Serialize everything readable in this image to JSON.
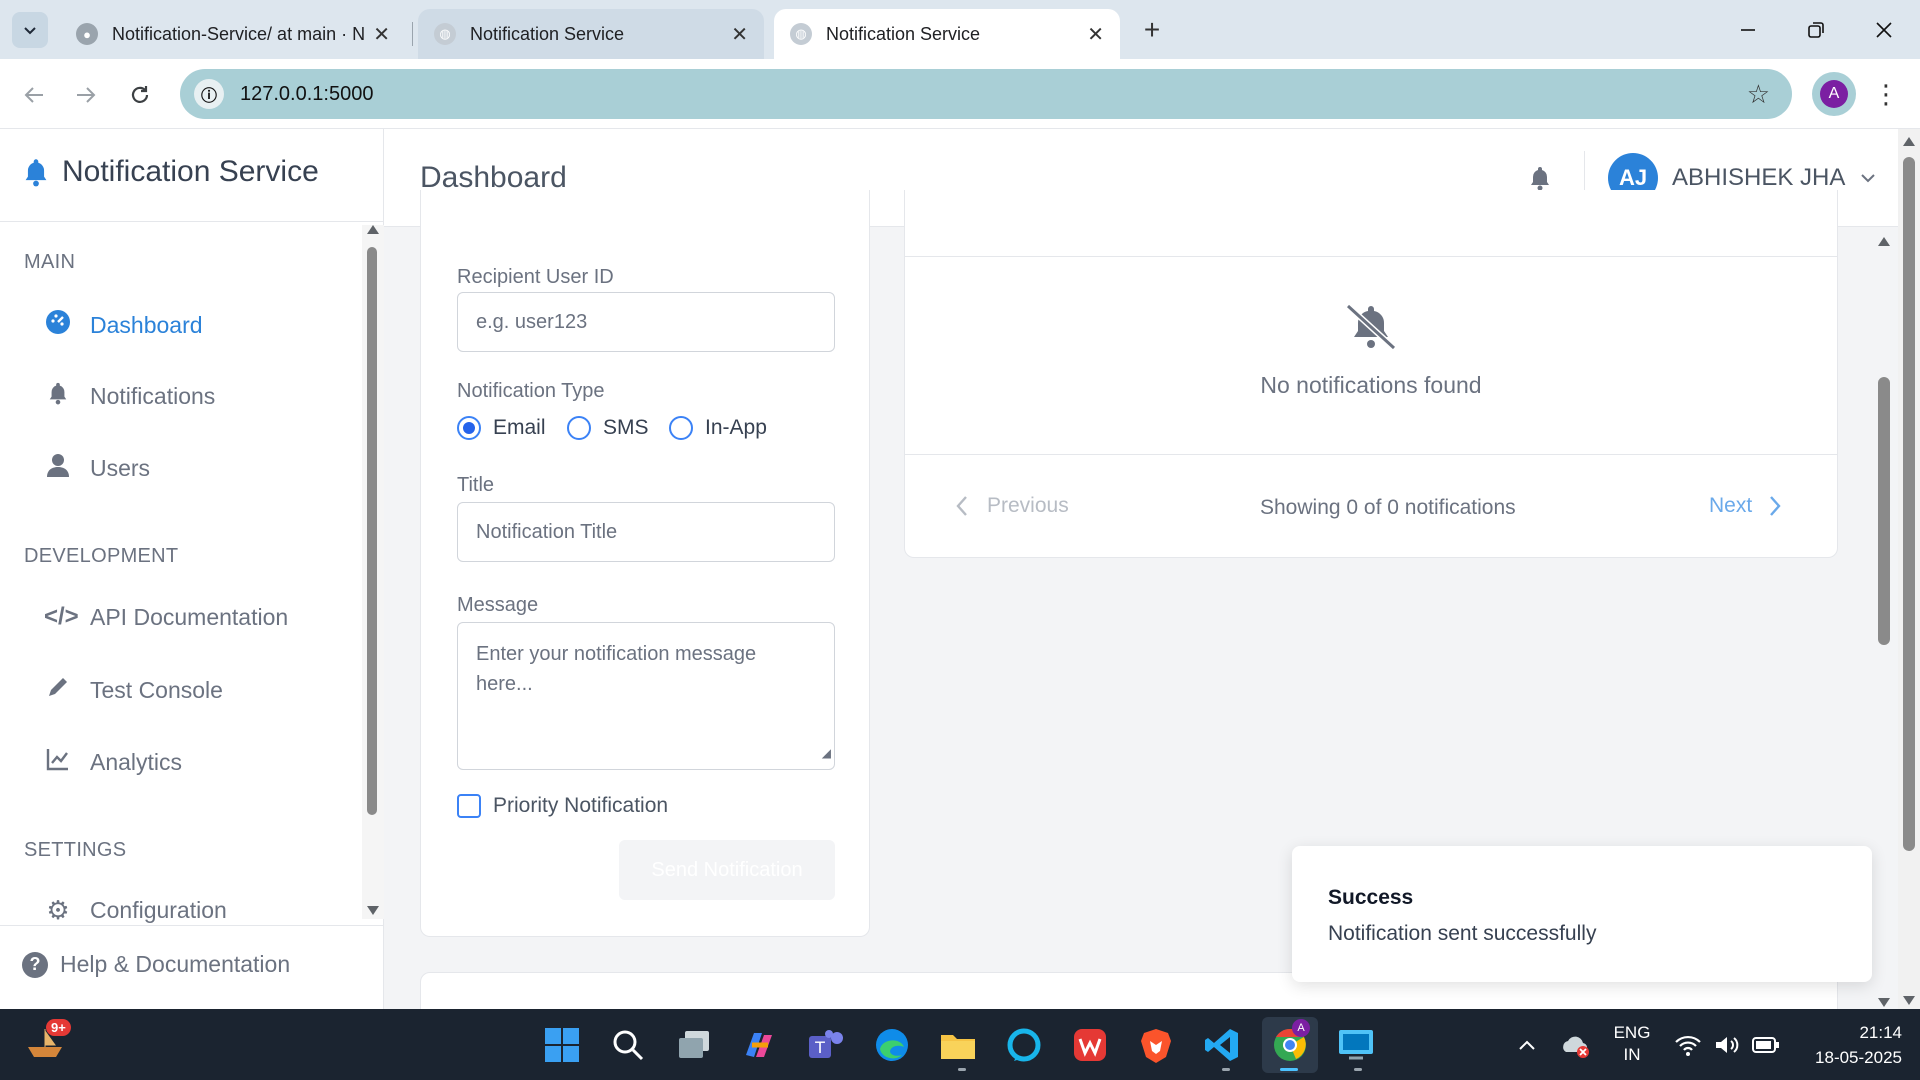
{
  "browser": {
    "tabs": [
      {
        "label": "Notification-Service/ at main · N",
        "icon": "github-icon"
      },
      {
        "label": "Notification Service",
        "icon": "globe-icon"
      },
      {
        "label": "Notification Service",
        "icon": "globe-icon"
      }
    ],
    "address": "127.0.0.1:5000",
    "profile_initial": "A"
  },
  "app": {
    "brand": "Notification Service",
    "page_title": "Dashboard",
    "user": {
      "initials": "AJ",
      "name": "ABHISHEK JHA"
    },
    "sidebar": {
      "sections": [
        {
          "title": "MAIN",
          "items": [
            {
              "label": "Dashboard",
              "icon": "dashboard-icon"
            },
            {
              "label": "Notifications",
              "icon": "bell-icon"
            },
            {
              "label": "Users",
              "icon": "user-icon"
            }
          ]
        },
        {
          "title": "DEVELOPMENT",
          "items": [
            {
              "label": "API Documentation",
              "icon": "code-icon"
            },
            {
              "label": "Test Console",
              "icon": "pencil-icon"
            },
            {
              "label": "Analytics",
              "icon": "chart-line-icon"
            }
          ]
        },
        {
          "title": "SETTINGS",
          "items": [
            {
              "label": "Configuration",
              "icon": "gear-icon"
            }
          ]
        }
      ],
      "help": "Help & Documentation"
    },
    "form": {
      "recipient_label": "Recipient User ID",
      "recipient_placeholder": "e.g. user123",
      "type_label": "Notification Type",
      "types": [
        "Email",
        "SMS",
        "In-App"
      ],
      "selected_type": "Email",
      "title_label": "Title",
      "title_placeholder": "Notification Title",
      "message_label": "Message",
      "message_placeholder": "Enter your notification message here...",
      "priority_label": "Priority Notification",
      "send_label": "Send Notification"
    },
    "list": {
      "empty_text": "No notifications found",
      "previous": "Previous",
      "next": "Next",
      "showing": "Showing 0 of 0 notifications"
    },
    "toast": {
      "title": "Success",
      "message": "Notification sent successfully"
    }
  },
  "taskbar": {
    "lang": "ENG",
    "region": "IN",
    "time": "21:14",
    "date": "18-05-2025",
    "badge": "9+"
  },
  "colors": {
    "accent": "#2b82d9",
    "omnibox": "#a9cfd6",
    "taskbar": "#1b2430"
  }
}
